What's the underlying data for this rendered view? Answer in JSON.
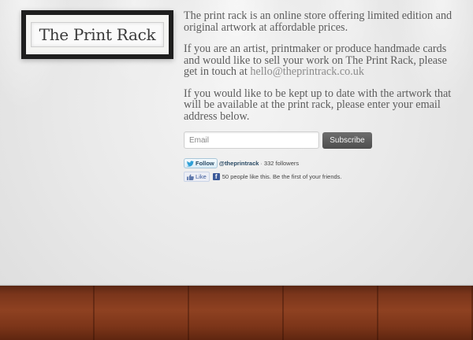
{
  "brand": {
    "logo_text": "The Print Rack"
  },
  "intro": {
    "p1": "The print rack is an online store offering limited edition and original artwork at affordable prices.",
    "p2_prefix": "If you are an artist, printmaker or produce handmade cards and would like to sell your work on The Print Rack, please get in touch at ",
    "p2_email": "hello@theprintrack.co.uk",
    "p3": "If you would like to be kept up to date with the artwork that will be available at the print rack, please enter your email address below."
  },
  "signup": {
    "email_placeholder": "Email",
    "email_value": "",
    "subscribe_label": "Subscribe"
  },
  "twitter": {
    "follow_label": "Follow",
    "handle": "@theprintrack",
    "separator": "·",
    "followers": "332 followers"
  },
  "facebook": {
    "like_label": "Like",
    "logo_letter": "f",
    "like_text": "50 people like this. Be the first of your friends."
  },
  "colors": {
    "link": "#8c8c8c",
    "body_text": "#5d5d5d",
    "button_bg": "#5a5a5a",
    "floor": "#7a351b"
  },
  "icons": {
    "twitter": "twitter-bird-icon",
    "facebook_thumb": "thumbs-up-icon",
    "facebook_logo": "facebook-logo-icon"
  }
}
